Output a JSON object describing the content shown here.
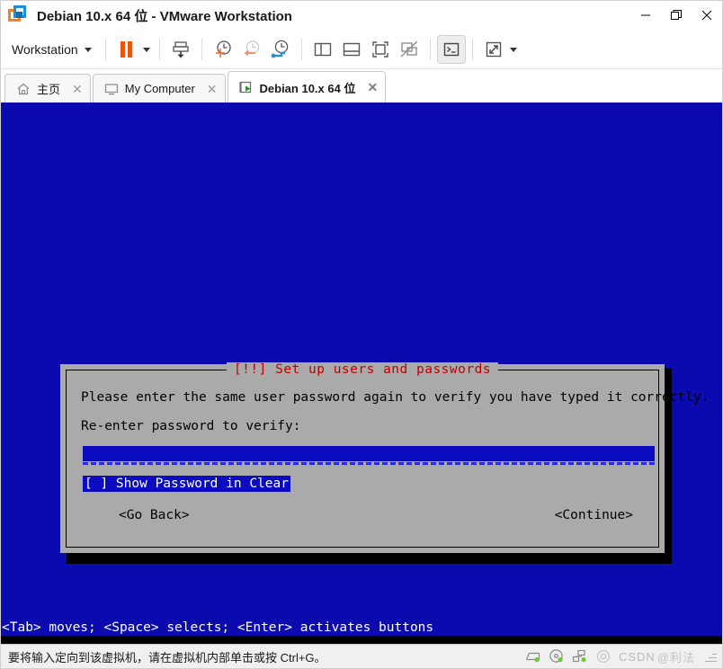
{
  "window": {
    "title": "Debian 10.x 64 位 - VMware Workstation",
    "app_icon": "vmware-logo-icon",
    "controls": [
      {
        "name": "minimize-button",
        "glyph": "—"
      },
      {
        "name": "restore-button",
        "glyph": "❐"
      },
      {
        "name": "close-button",
        "glyph": "✕"
      }
    ]
  },
  "toolbar": {
    "menu_label": "Workstation",
    "items": [
      {
        "name": "suspend-button",
        "icon": "pause-icon"
      },
      {
        "name": "power-dropdown",
        "icon": "chevron-down-icon"
      },
      {
        "name": "install-tools-button",
        "icon": "download-to-vm-icon"
      },
      {
        "name": "take-snapshot-button",
        "icon": "clock-plus-icon"
      },
      {
        "name": "revert-snapshot-button",
        "icon": "clock-back-icon"
      },
      {
        "name": "manage-snapshots-button",
        "icon": "clock-wrench-icon"
      },
      {
        "name": "show-library-button",
        "icon": "sidebar-panel-icon"
      },
      {
        "name": "show-thumbnails-button",
        "icon": "bottom-panel-icon"
      },
      {
        "name": "fullscreen-button",
        "icon": "fullscreen-icon"
      },
      {
        "name": "unity-mode-button",
        "icon": "unity-disabled-icon"
      },
      {
        "name": "console-view-button",
        "icon": "terminal-icon"
      },
      {
        "name": "stretch-view-button",
        "icon": "expand-arrows-icon"
      },
      {
        "name": "stretch-view-dropdown",
        "icon": "chevron-down-icon"
      }
    ]
  },
  "tabs": [
    {
      "name": "tab-home",
      "label": "主页",
      "icon": "home-icon",
      "active": false,
      "close": "✕"
    },
    {
      "name": "tab-my-computer",
      "label": "My Computer",
      "icon": "monitor-icon",
      "active": false,
      "close": "✕"
    },
    {
      "name": "tab-debian-vm",
      "label": "Debian 10.x 64 位",
      "icon": "vm-running-icon",
      "active": true,
      "close": "✕"
    }
  ],
  "vm": {
    "background_color": "#0a0aaf",
    "dialog": {
      "title": "[!!] Set up users and passwords",
      "title_color": "#c00000",
      "background_color": "#aaaaaa",
      "prompt": "Please enter the same user password again to verify you have typed it correctly.",
      "field_label": "Re-enter password to verify:",
      "password_value": "",
      "checkbox_label": "[ ] Show Password in Clear",
      "checkbox_focused": true,
      "buttons": [
        {
          "name": "go-back-button",
          "label": "<Go Back>"
        },
        {
          "name": "continue-button",
          "label": "<Continue>"
        }
      ]
    },
    "key_hint": "<Tab> moves; <Space> selects; <Enter> activates buttons"
  },
  "statusbar": {
    "message": "要将输入定向到该虚拟机，请在虚拟机内部单击或按 Ctrl+G。",
    "devices": [
      {
        "name": "hard-disk-icon",
        "connected": true
      },
      {
        "name": "cd-dvd-icon",
        "connected": true
      },
      {
        "name": "network-adapter-icon",
        "connected": true
      },
      {
        "name": "sound-card-icon",
        "connected": false
      }
    ],
    "watermark_latin": "CSDN",
    "watermark_cn": "@利法"
  }
}
